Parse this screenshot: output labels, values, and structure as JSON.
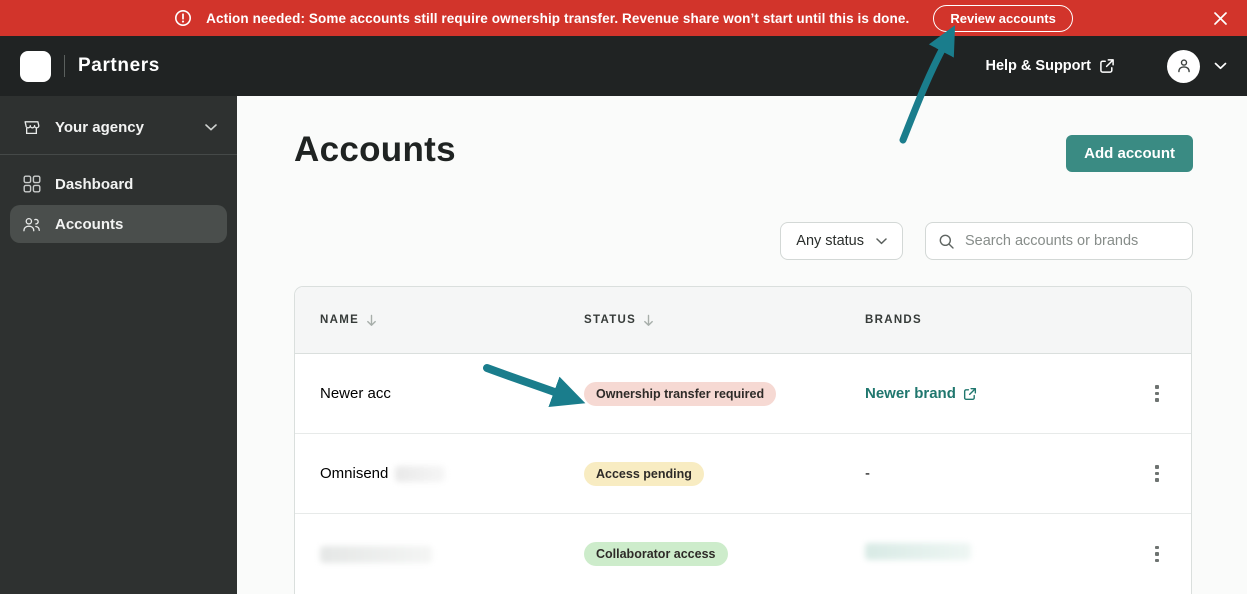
{
  "banner": {
    "icon": "alert-circle-icon",
    "message": "Action needed: Some accounts still require ownership transfer. Revenue share won’t start until this is done.",
    "review_button_label": "Review accounts",
    "close_icon": "close-icon",
    "bg_color": "#d2342b"
  },
  "header": {
    "logo_icon": "omnisend-logo-icon",
    "product_name": "Partners",
    "help_label": "Help & Support",
    "help_icon": "external-link-icon",
    "avatar_icon": "user-icon",
    "menu_icon": "chevron-down-icon"
  },
  "sidebar": {
    "agency": {
      "icon": "storefront-icon",
      "label": "Your agency",
      "chevron": "chevron-down-icon"
    },
    "items": [
      {
        "icon": "dashboard-grid-icon",
        "label": "Dashboard",
        "selected": false
      },
      {
        "icon": "people-icon",
        "label": "Accounts",
        "selected": true
      }
    ]
  },
  "page": {
    "title": "Accounts",
    "add_account_label": "Add account",
    "status_filter_value": "Any status",
    "search_placeholder": "Search accounts or brands",
    "search_icon": "search-icon"
  },
  "table": {
    "columns": [
      "NAME",
      "STATUS",
      "BRANDS"
    ],
    "sort_icon_columns": [
      "NAME",
      "STATUS"
    ],
    "rows": [
      {
        "name": "Newer acc",
        "status": "Ownership transfer required",
        "status_bg": "#f6d9d3",
        "brand": "Newer brand",
        "brand_is_link": true
      },
      {
        "name": "Omnisend",
        "name_partially_redacted": true,
        "status": "Access pending",
        "status_bg": "#f8ecc2",
        "brand": "-",
        "brand_is_link": false
      },
      {
        "name": "",
        "name_redacted": true,
        "status": "Collaborator access",
        "status_bg": "#cdeccb",
        "brand": "",
        "brand_redacted": true
      }
    ]
  },
  "annotations": {
    "arrow_color": "#1a7d8c",
    "arrows": [
      {
        "points_to": "review-accounts-button"
      },
      {
        "points_to": "ownership-transfer-required-badge"
      }
    ]
  },
  "colors": {
    "accent_teal": "#3a8b83",
    "link_teal": "#20776e",
    "banner_red": "#d2342b",
    "topbar_dark": "#202323",
    "sidebar_dark": "#2e3130"
  }
}
